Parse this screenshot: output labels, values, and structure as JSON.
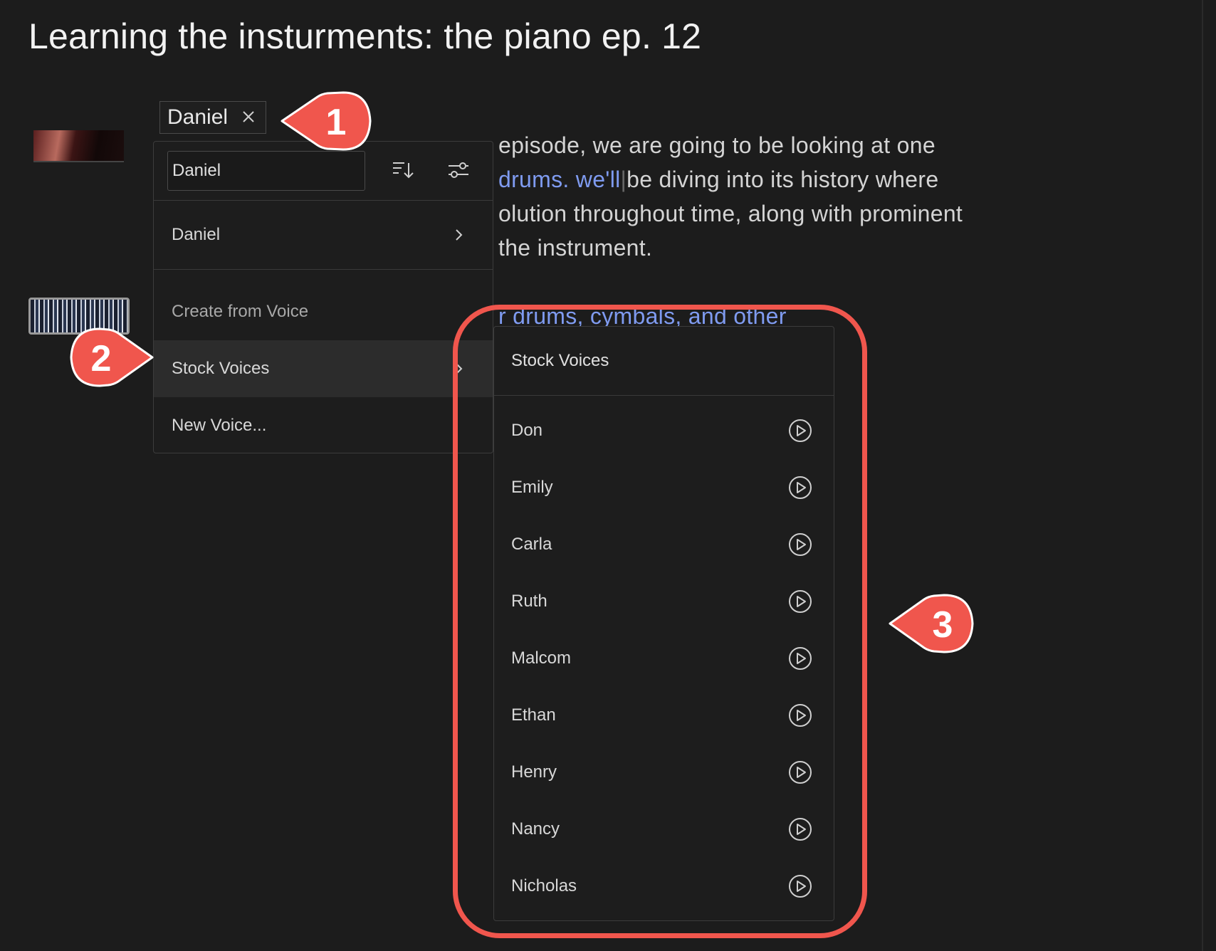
{
  "page": {
    "title": "Learning the insturments: the piano ep. 12"
  },
  "paragraph": {
    "line1": "episode, we are going to be looking at one",
    "line2_highlight": "drums. we'll",
    "line2_rest": "be diving into its history where",
    "line3": "olution throughout time, along with prominent",
    "line4": "the instrument.",
    "line5_partial": "r drums, cymbals, and other"
  },
  "voice_chip": {
    "label": "Daniel",
    "remove_icon": "close-icon"
  },
  "voice_menu": {
    "search_value": "Daniel",
    "sort_icon": "sort-descending-icon",
    "filter_icon": "sliders-icon",
    "current_voice": "Daniel",
    "items": [
      "Create from Voice",
      "Stock Voices",
      "New Voice..."
    ]
  },
  "stock_voices": {
    "header": "Stock Voices",
    "play_icon": "play-circle-icon",
    "voices": [
      "Don",
      "Emily",
      "Carla",
      "Ruth",
      "Malcom",
      "Ethan",
      "Henry",
      "Nancy",
      "Nicholas"
    ]
  },
  "annotations": {
    "callout_1": "1",
    "callout_2": "2",
    "callout_3": "3",
    "color": "#f0564d"
  },
  "colors": {
    "background": "#1c1c1c",
    "highlight_text": "#7f9bf0"
  }
}
